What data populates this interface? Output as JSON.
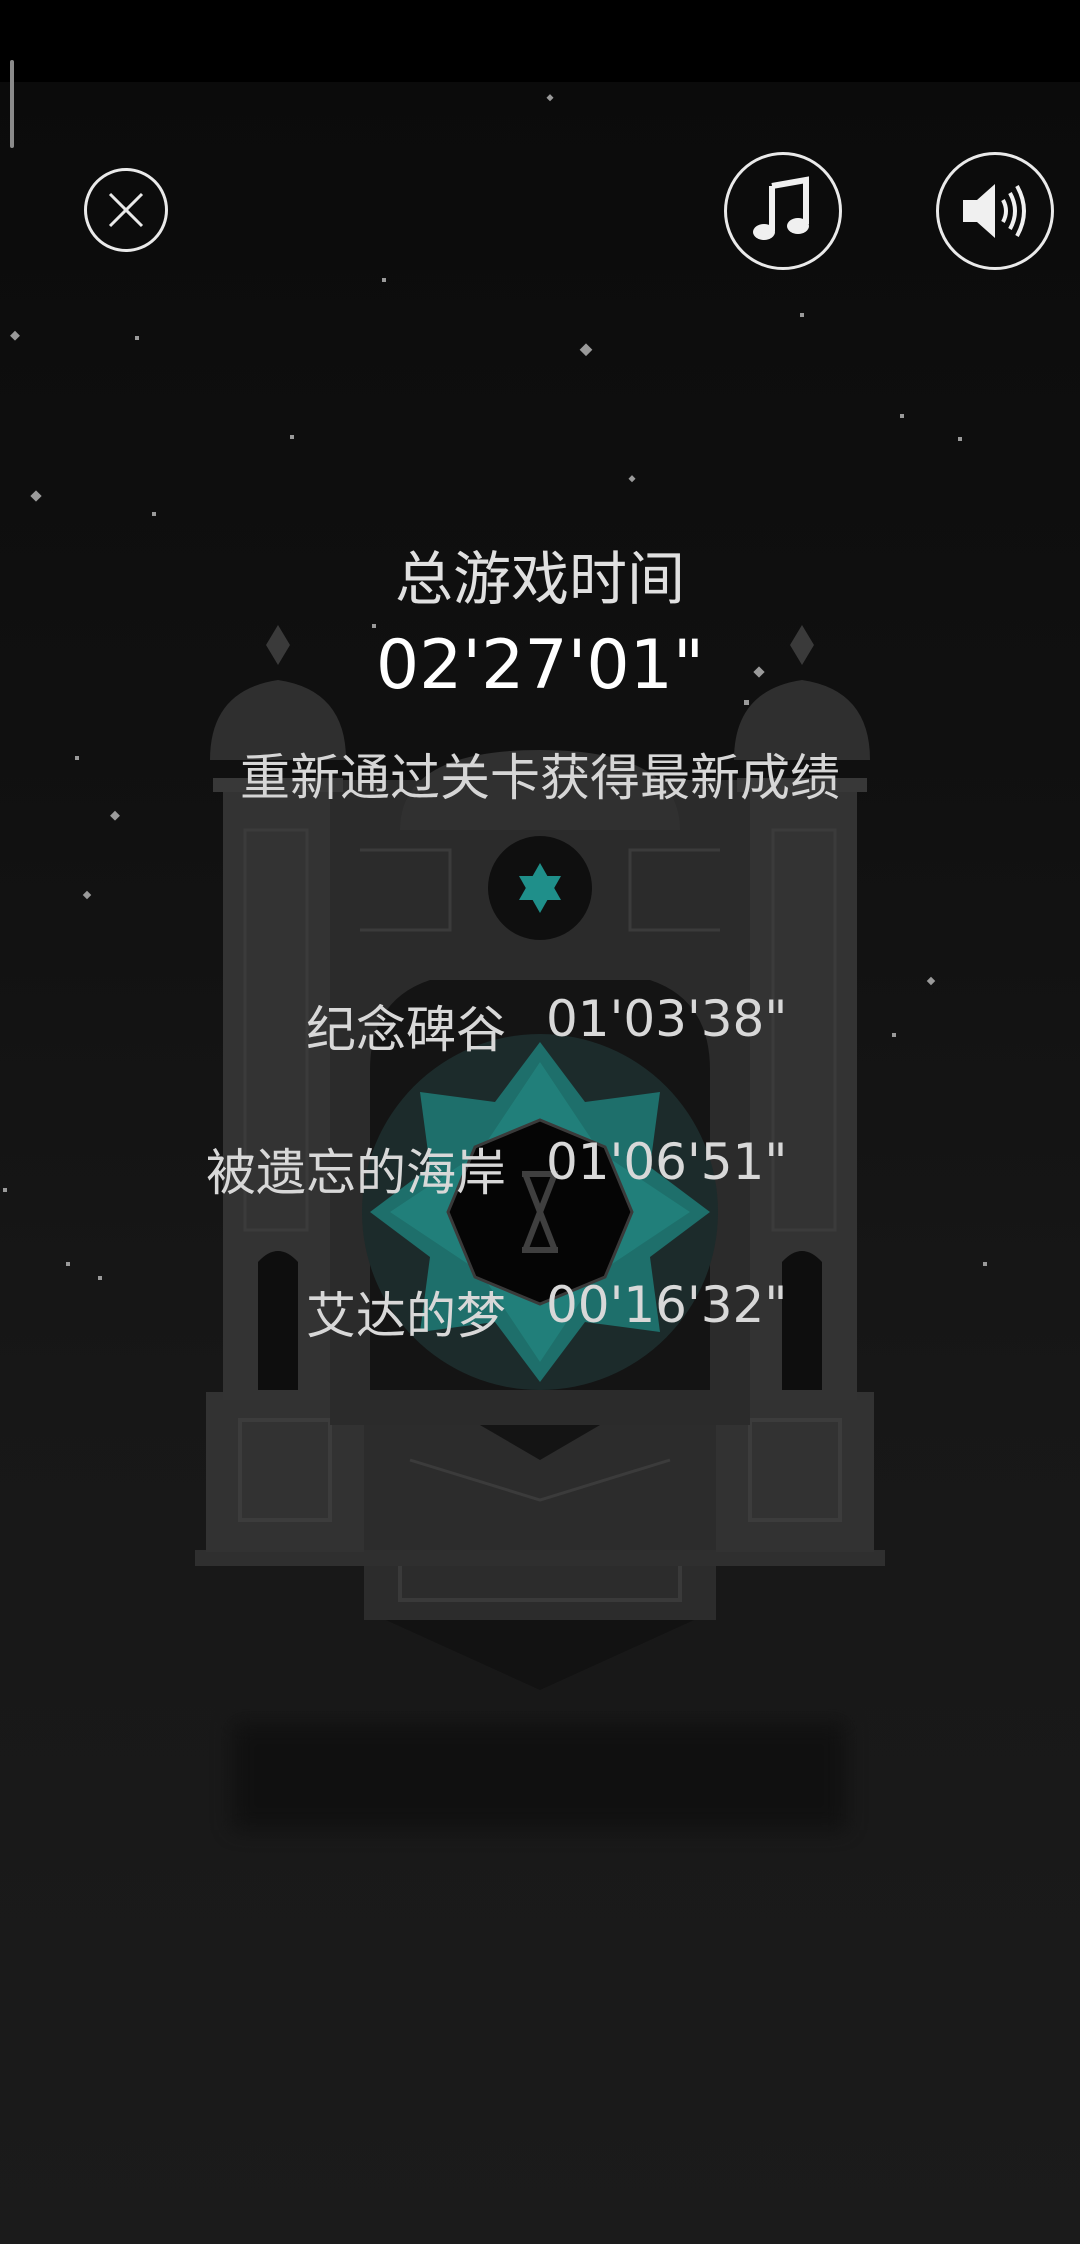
{
  "header": {
    "close_icon": "close-icon",
    "music_icon": "music-note-icon",
    "sound_icon": "speaker-volume-icon"
  },
  "summary": {
    "label": "总游戏时间",
    "total_time": "02'27'01\"",
    "hint": "重新通过关卡获得最新成绩"
  },
  "levels": [
    {
      "name": "纪念碑谷",
      "time": "01'03'38\""
    },
    {
      "name": "被遗忘的海岸",
      "time": "01'06'51\""
    },
    {
      "name": "艾达的梦",
      "time": "00'16'32\""
    }
  ],
  "colors": {
    "background": "#141414",
    "monument": "#2e2e2e",
    "accent_teal": "#2aa6a0",
    "text": "#e4e4e4"
  }
}
